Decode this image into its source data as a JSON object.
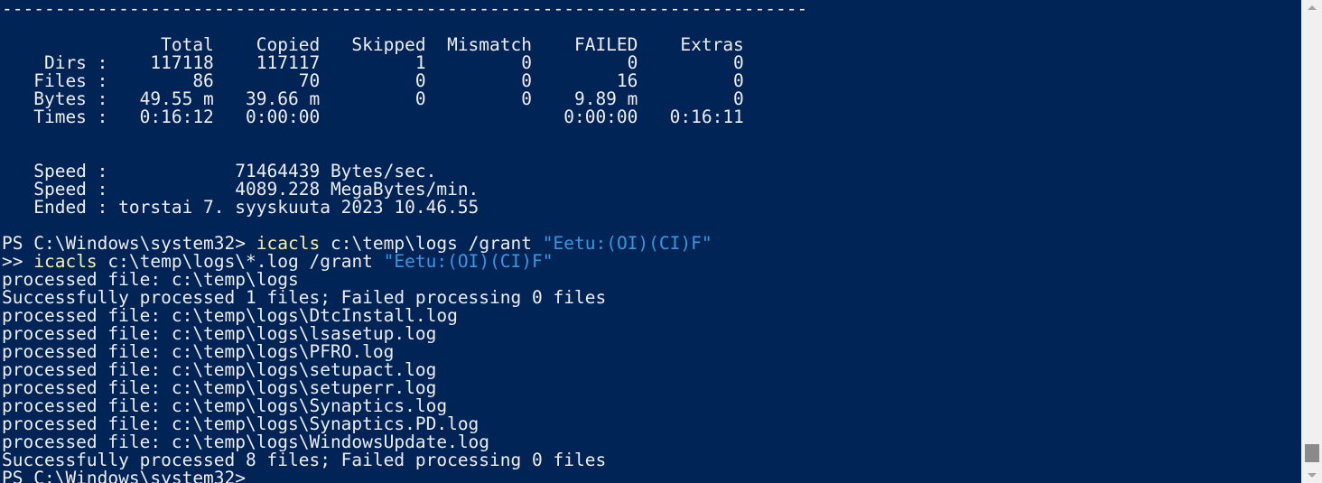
{
  "colors": {
    "background": "#012456",
    "foreground": "#eeedf0",
    "command": "#f9f1a5",
    "string": "#3a96dd",
    "scrollbar_track": "#f0f0f0",
    "scrollbar_thumb": "#8a8a8a"
  },
  "icons": {
    "scroll_up": "triangle-up",
    "scroll_down": "triangle-down"
  },
  "console": {
    "lines": [
      [
        {
          "t": "----------------------------------------------------------------------------",
          "c": "ps"
        }
      ],
      [
        {
          "t": "",
          "c": "ps"
        }
      ],
      [
        {
          "t": "               Total    Copied   Skipped  Mismatch    FAILED    Extras",
          "c": "ps"
        }
      ],
      [
        {
          "t": "    Dirs :    117118    117117         1         0         0         0",
          "c": "ps"
        }
      ],
      [
        {
          "t": "   Files :        86        70         0         0        16         0",
          "c": "ps"
        }
      ],
      [
        {
          "t": "   Bytes :   49.55 m   39.66 m         0         0    9.89 m         0",
          "c": "ps"
        }
      ],
      [
        {
          "t": "   Times :   0:16:12   0:00:00                       0:00:00   0:16:11",
          "c": "ps"
        }
      ],
      [
        {
          "t": "",
          "c": "ps"
        }
      ],
      [
        {
          "t": "",
          "c": "ps"
        }
      ],
      [
        {
          "t": "   Speed :            71464439 Bytes/sec.",
          "c": "ps"
        }
      ],
      [
        {
          "t": "   Speed :            4089.228 MegaBytes/min.",
          "c": "ps"
        }
      ],
      [
        {
          "t": "   Ended : torstai 7. syyskuuta 2023 10.46.55",
          "c": "ps"
        }
      ],
      [
        {
          "t": "",
          "c": "ps"
        }
      ],
      [
        {
          "t": "PS C:\\Windows\\system32> ",
          "c": "ps"
        },
        {
          "t": "icacls",
          "c": "cmd"
        },
        {
          "t": " c:\\temp\\logs /grant ",
          "c": "arg"
        },
        {
          "t": "\"Eetu:(OI)(CI)F\"",
          "c": "str"
        }
      ],
      [
        {
          "t": ">> ",
          "c": "ps"
        },
        {
          "t": "icacls",
          "c": "cmd"
        },
        {
          "t": " c:\\temp\\logs\\*.log /grant ",
          "c": "arg"
        },
        {
          "t": "\"Eetu:(OI)(CI)F\"",
          "c": "str"
        }
      ],
      [
        {
          "t": "processed file: c:\\temp\\logs",
          "c": "ps"
        }
      ],
      [
        {
          "t": "Successfully processed 1 files; Failed processing 0 files",
          "c": "ps"
        }
      ],
      [
        {
          "t": "processed file: c:\\temp\\logs\\DtcInstall.log",
          "c": "ps"
        }
      ],
      [
        {
          "t": "processed file: c:\\temp\\logs\\lsasetup.log",
          "c": "ps"
        }
      ],
      [
        {
          "t": "processed file: c:\\temp\\logs\\PFRO.log",
          "c": "ps"
        }
      ],
      [
        {
          "t": "processed file: c:\\temp\\logs\\setupact.log",
          "c": "ps"
        }
      ],
      [
        {
          "t": "processed file: c:\\temp\\logs\\setuperr.log",
          "c": "ps"
        }
      ],
      [
        {
          "t": "processed file: c:\\temp\\logs\\Synaptics.log",
          "c": "ps"
        }
      ],
      [
        {
          "t": "processed file: c:\\temp\\logs\\Synaptics.PD.log",
          "c": "ps"
        }
      ],
      [
        {
          "t": "processed file: c:\\temp\\logs\\WindowsUpdate.log",
          "c": "ps"
        }
      ],
      [
        {
          "t": "Successfully processed 8 files; Failed processing 0 files",
          "c": "ps"
        }
      ],
      [
        {
          "t": "PS C:\\Windows\\system32> ",
          "c": "ps"
        }
      ]
    ]
  }
}
